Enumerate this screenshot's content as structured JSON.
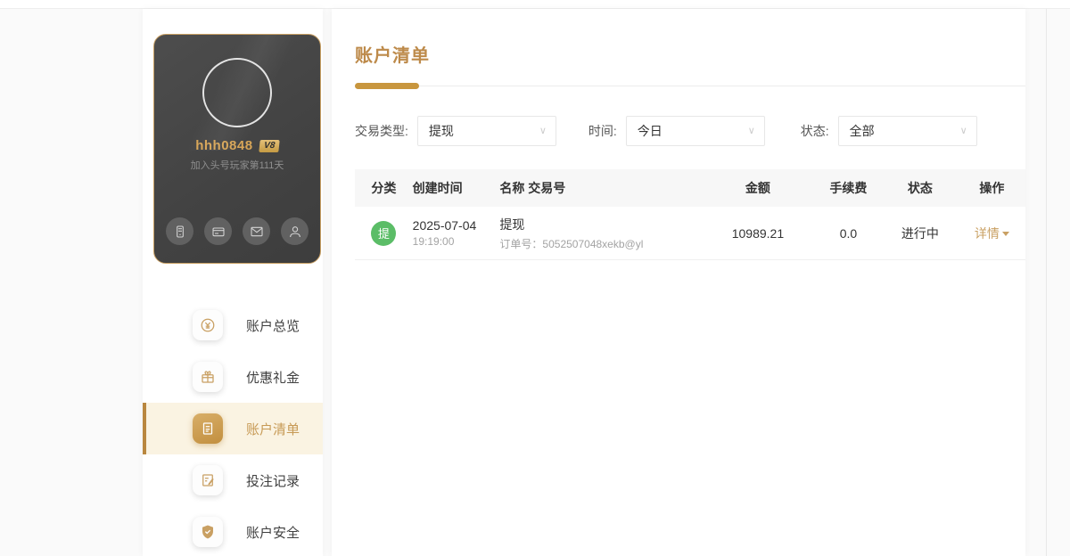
{
  "colors": {
    "accent_gold": "#bd8a4a",
    "gold_dark": "#b9873f",
    "active_item_bg": "#faf3e2",
    "green_badge": "#5bbd67",
    "card_border": "#c9a063"
  },
  "profile": {
    "username": "hhh0848",
    "vip_badge": "V8",
    "join_text": "加入头号玩家第111天",
    "quick_icons": [
      "wallet-icon",
      "bank-card-icon",
      "mail-icon",
      "user-icon"
    ]
  },
  "sidebar": {
    "active_item": "账户清单",
    "items": [
      {
        "label": "账户总览",
        "icon": "coin-icon"
      },
      {
        "label": "优惠礼金",
        "icon": "gift-icon"
      },
      {
        "label": "账户清单",
        "icon": "document-icon"
      },
      {
        "label": "投注记录",
        "icon": "record-icon"
      },
      {
        "label": "账户安全",
        "icon": "shield-icon"
      }
    ]
  },
  "main": {
    "title": "账户清单",
    "filters": {
      "type": {
        "label": "交易类型:",
        "value": "提现"
      },
      "time": {
        "label": "时间:",
        "value": "今日"
      },
      "status": {
        "label": "状态:",
        "value": "全部"
      }
    },
    "table": {
      "headers": [
        "分类",
        "创建时间",
        "名称 交易号",
        "金额",
        "手续费",
        "状态",
        "操作"
      ],
      "rows": [
        {
          "badge": "提",
          "date": "2025-07-04",
          "time": "19:19:00",
          "name": "提现",
          "order": "订单号：5052507048xekb@yl",
          "amount": "10989.21",
          "fee": "0.0",
          "status": "进行中",
          "action": "详情"
        }
      ]
    }
  }
}
